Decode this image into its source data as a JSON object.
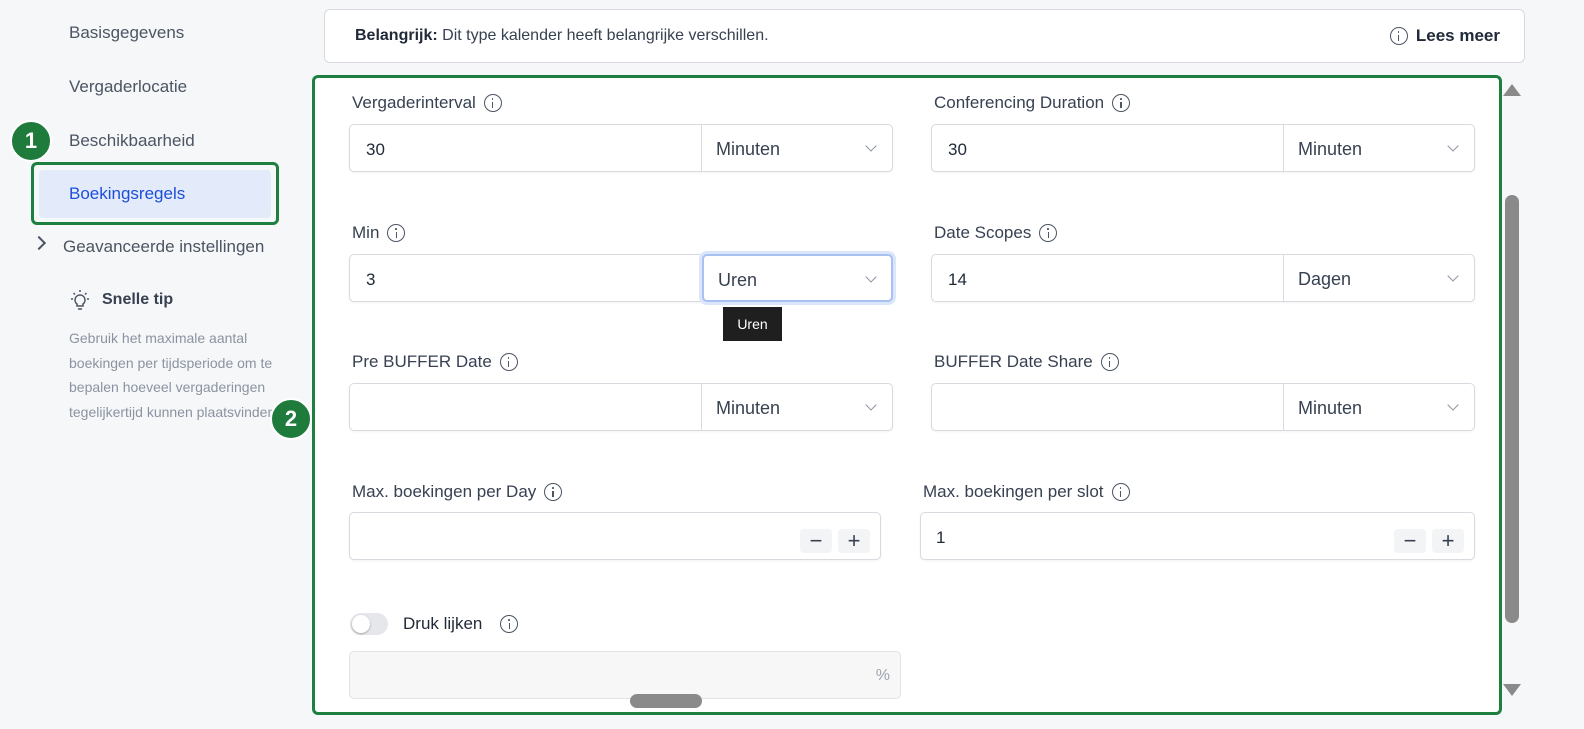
{
  "sidebar": {
    "items": [
      {
        "label": "Basisgegevens"
      },
      {
        "label": "Vergaderlocatie"
      },
      {
        "label": "Beschikbaarheid"
      },
      {
        "label": "Boekingsregels"
      },
      {
        "label": "Geavanceerde instellingen"
      }
    ],
    "tip_title": "Snelle tip",
    "tip_text": "Gebruik het maximale aantal boekingen per tijdsperiode om te bepalen hoeveel vergaderingen tegelijkertijd kunnen plaatsvinden."
  },
  "badges": {
    "one": "1",
    "two": "2"
  },
  "notice": {
    "bold": "Belangrijk:",
    "text": " Dit type kalender heeft belangrijke verschillen.",
    "link": "Lees meer"
  },
  "fields": {
    "vergaderinterval": {
      "label": "Vergaderinterval",
      "value": "30",
      "unit": "Minuten"
    },
    "conferencing": {
      "label": "Conferencing Duration",
      "value": "30",
      "unit": "Minuten"
    },
    "min": {
      "label": "Min",
      "value": "3",
      "unit": "Uren"
    },
    "date_scopes": {
      "label": "Date Scopes",
      "value": "14",
      "unit": "Dagen"
    },
    "pre_buffer": {
      "label": "Pre BUFFER Date",
      "value": "",
      "unit": "Minuten"
    },
    "buffer_share": {
      "label": "BUFFER Date Share",
      "value": "",
      "unit": "Minuten"
    },
    "max_day": {
      "label": "Max. boekingen per Day",
      "value": ""
    },
    "max_slot": {
      "label": "Max. boekingen per slot",
      "value": "1"
    },
    "druk": {
      "label": "Druk lijken",
      "suffix": "%"
    }
  },
  "tooltip": "Uren",
  "stepper": {
    "minus": "−",
    "plus": "+"
  }
}
